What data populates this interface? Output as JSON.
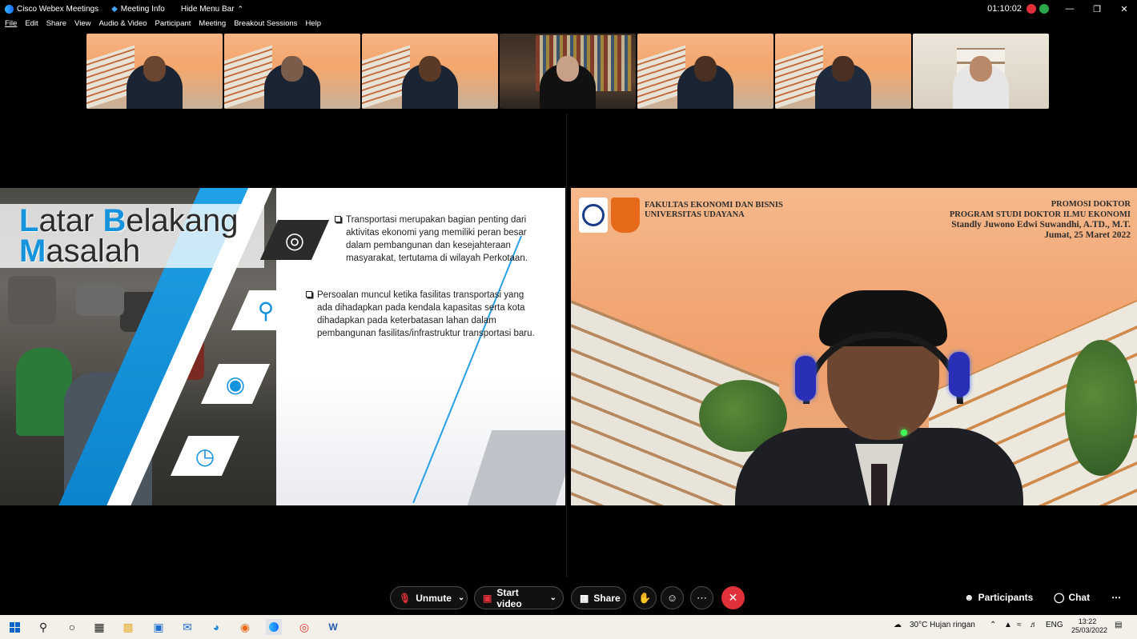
{
  "titlebar": {
    "app_name": "Cisco Webex Meetings",
    "meeting_info": "Meeting Info",
    "hide_menu": "Hide Menu Bar",
    "clock": "01:10:02"
  },
  "menu": [
    "File",
    "Edit",
    "Share",
    "View",
    "Audio & Video",
    "Participant",
    "Meeting",
    "Breakout Sessions",
    "Help"
  ],
  "slide": {
    "title_line1_cap1": "L",
    "title_line1_rest1": "atar ",
    "title_line1_cap2": "B",
    "title_line1_rest2": "elakang",
    "title_line2_cap": "M",
    "title_line2_rest": "asalah",
    "bullets": [
      "Transportasi merupakan bagian penting dari aktivitas ekonomi yang memiliki peran besar dalam pembangunan dan kesejahteraan masyarakat, tertutama di wilayah Perkotaan.",
      "Persoalan muncul ketika fasilitas transportasi yang ada dihadapkan pada kendala kapasitas serta kota dihadapkan pada keterbatasan lahan dalam pembangunan fasilitas/infrastruktur transportasi baru."
    ]
  },
  "video_banner": {
    "faculty_line1": "FAKULTAS EKONOMI DAN BISNIS",
    "faculty_line2": "UNIVERSITAS UDAYANA",
    "promo": "PROMOSI DOKTOR",
    "program": "PROGRAM STUDI DOKTOR ILMU EKONOMI",
    "candidate": "Standly Juwono Edwi Suwandhi, A.TD., M.T.",
    "date": "Jumat, 25 Maret 2022"
  },
  "controls": {
    "unmute": "Unmute",
    "start_video": "Start video",
    "share": "Share",
    "participants": "Participants",
    "chat": "Chat"
  },
  "taskbar": {
    "weather": "30°C  Hujan ringan",
    "lang": "ENG",
    "time": "13:22",
    "date": "25/03/2022"
  }
}
